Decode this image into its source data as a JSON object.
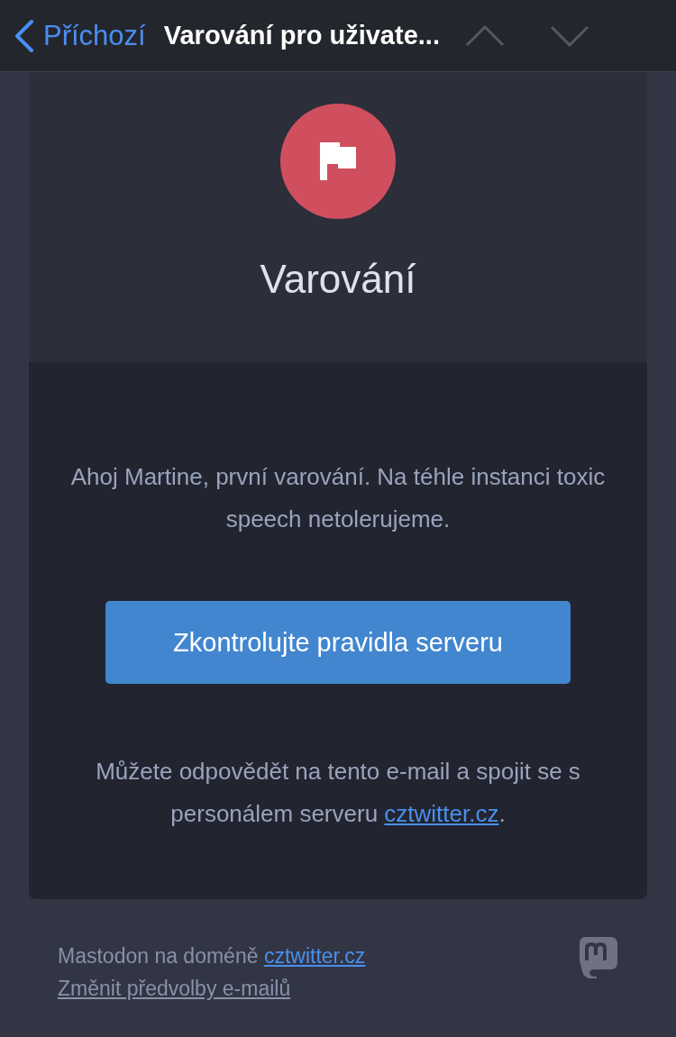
{
  "nav": {
    "back_label": "Příchozí",
    "title": "Varování pro uživate..."
  },
  "header": {
    "heading": "Varování"
  },
  "body": {
    "message": "Ahoj Martine, první varování. Na téhle instanci toxic speech netolerujeme.",
    "button": "Zkontrolujte pravidla serveru",
    "reply_text": "Můžete odpovědět na tento e-mail a spojit se s personálem serveru ",
    "reply_link": "cztwitter.cz",
    "reply_end": "."
  },
  "footer": {
    "domain_text": "Mastodon na doméně ",
    "domain_link": "cztwitter.cz",
    "preferences_link": "Změnit předvolby e-mailů"
  }
}
